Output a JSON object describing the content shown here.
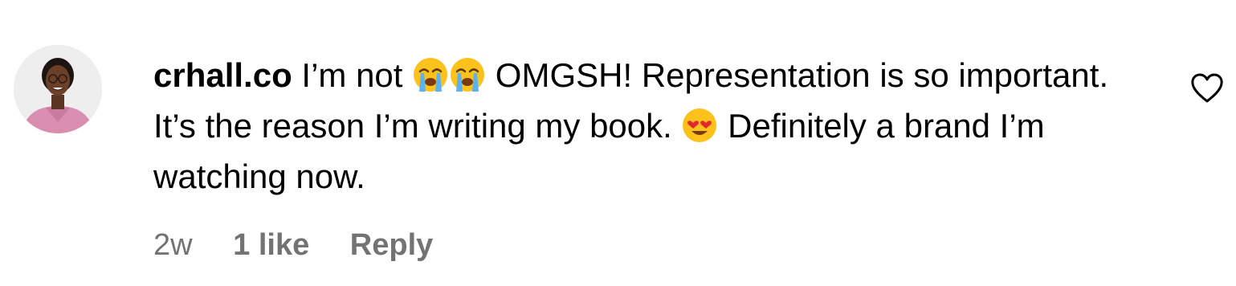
{
  "comment": {
    "username": "crhall.co",
    "text_before_emoji": " I’m not ",
    "emoji_1": "loudly-crying-face-emoji",
    "emoji_2": "loudly-crying-face-emoji",
    "text_middle": " OMGSH! Representation is so important. It’s the reason I’m writing my book. ",
    "emoji_3": "smiling-face-with-heart-eyes-emoji",
    "text_after_emoji": " Definitely a brand I’m watching now.",
    "timestamp": "2w",
    "likes": "1 like",
    "reply_label": "Reply",
    "like_icon": "heart-outline-icon"
  },
  "colors": {
    "text": "#000000",
    "meta_text": "#737373"
  }
}
